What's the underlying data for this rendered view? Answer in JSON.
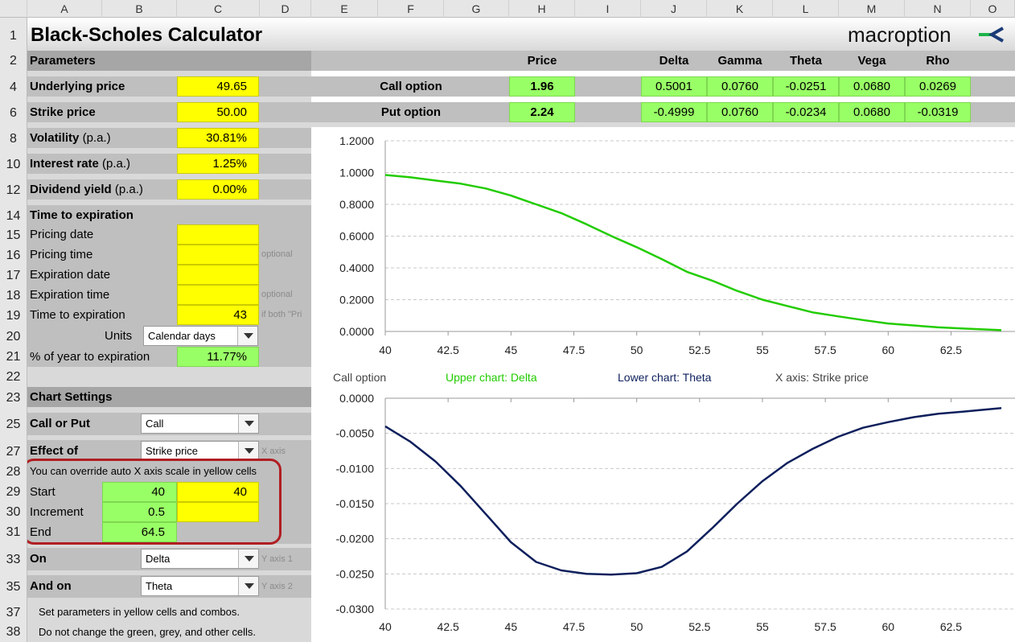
{
  "columns": [
    "A",
    "B",
    "C",
    "D",
    "E",
    "F",
    "G",
    "H",
    "I",
    "J",
    "K",
    "L",
    "M",
    "N",
    "O"
  ],
  "rows": [
    "1",
    "2",
    "4",
    "6",
    "8",
    "10",
    "12",
    "14",
    "15",
    "16",
    "17",
    "18",
    "19",
    "20",
    "21",
    "22",
    "23",
    "25",
    "27",
    "28",
    "29",
    "30",
    "31",
    "33",
    "35",
    "37",
    "38"
  ],
  "title": "Black-Scholes Calculator",
  "logo": {
    "text": "macroption",
    "accent": "#1db34a"
  },
  "params": {
    "header": "Parameters",
    "underlying_label": "Underlying price",
    "underlying_value": "49.65",
    "strike_label": "Strike price",
    "strike_value": "50.00",
    "volatility_label": "Volatility",
    "volatility_suffix": "(p.a.)",
    "volatility_value": "30.81%",
    "interest_label": "Interest rate",
    "interest_suffix": "(p.a.)",
    "interest_value": "1.25%",
    "dividend_label": "Dividend yield",
    "dividend_suffix": "(p.a.)",
    "dividend_value": "0.00%"
  },
  "time": {
    "header": "Time to expiration",
    "pricing_date": "Pricing date",
    "pricing_time": "Pricing time",
    "expiration_date": "Expiration date",
    "expiration_time": "Expiration time",
    "tte_label": "Time to expiration",
    "tte_value": "43",
    "optional1": "optional",
    "optional2": "optional",
    "if_both": "if both \"Pri",
    "units_label": "Units",
    "units_value": "Calendar days",
    "pct_label": "% of year to expiration",
    "pct_value": "11.77%"
  },
  "chart_settings": {
    "header": "Chart Settings",
    "call_put_label": "Call or Put",
    "call_put_value": "Call",
    "effect_label": "Effect of",
    "effect_value": "Strike price",
    "effect_note": "X axis",
    "override_text": "You can override auto X axis scale in yellow cells",
    "start_label": "Start",
    "start_auto": "40",
    "start_override": "40",
    "increment_label": "Increment",
    "increment_auto": "0.5",
    "end_label": "End",
    "end_auto": "64.5",
    "on_label": "On",
    "on_value": "Delta",
    "on_note": "Y axis 1",
    "andon_label": "And on",
    "andon_value": "Theta",
    "andon_note": "Y axis 2",
    "instr1": "Set parameters in yellow cells and combos.",
    "instr2": "Do not change the green, grey, and other cells."
  },
  "greeks": {
    "headers": [
      "Price",
      "Delta",
      "Gamma",
      "Theta",
      "Vega",
      "Rho"
    ],
    "call": {
      "label": "Call option",
      "price": "1.96",
      "delta": "0.5001",
      "gamma": "0.0760",
      "theta": "-0.0251",
      "vega": "0.0680",
      "rho": "0.0269"
    },
    "put": {
      "label": "Put option",
      "price": "2.24",
      "delta": "-0.4999",
      "gamma": "0.0760",
      "theta": "-0.0234",
      "vega": "0.0680",
      "rho": "-0.0319"
    }
  },
  "legend": {
    "option": "Call option",
    "upper": "Upper chart: Delta",
    "lower": "Lower chart: Theta",
    "xaxis": "X axis: Strike price",
    "upper_color": "#22cc00",
    "lower_color": "#0d1f5c"
  },
  "chart_data": [
    {
      "type": "line",
      "series": [
        {
          "name": "Delta",
          "color": "#22cc00"
        }
      ],
      "x": [
        40,
        41,
        42,
        43,
        44,
        45,
        46,
        47,
        48,
        49,
        50,
        51,
        52,
        53,
        54,
        55,
        56,
        57,
        58,
        59,
        60,
        61,
        62,
        63,
        64.5
      ],
      "y": [
        0.985,
        0.97,
        0.95,
        0.93,
        0.9,
        0.855,
        0.8,
        0.745,
        0.675,
        0.6,
        0.53,
        0.455,
        0.375,
        0.32,
        0.255,
        0.2,
        0.16,
        0.12,
        0.095,
        0.072,
        0.05,
        0.038,
        0.026,
        0.018,
        0.008
      ],
      "ylim": [
        0,
        1.2
      ],
      "y_ticks": [
        "1.2000",
        "1.0000",
        "0.8000",
        "0.6000",
        "0.4000",
        "0.2000",
        "0.0000"
      ],
      "x_ticks": [
        "40",
        "42.5",
        "45",
        "47.5",
        "50",
        "52.5",
        "55",
        "57.5",
        "60",
        "62.5"
      ]
    },
    {
      "type": "line",
      "series": [
        {
          "name": "Theta",
          "color": "#0d1f5c"
        }
      ],
      "x": [
        40,
        41,
        42,
        43,
        44,
        45,
        46,
        47,
        48,
        49,
        50,
        51,
        52,
        53,
        54,
        55,
        56,
        57,
        58,
        59,
        60,
        61,
        62,
        63,
        64.5
      ],
      "y": [
        -0.004,
        -0.0062,
        -0.009,
        -0.0125,
        -0.0165,
        -0.0205,
        -0.0233,
        -0.0245,
        -0.025,
        -0.0251,
        -0.0249,
        -0.024,
        -0.0218,
        -0.0185,
        -0.015,
        -0.0118,
        -0.0092,
        -0.0072,
        -0.0055,
        -0.0042,
        -0.0034,
        -0.0027,
        -0.0022,
        -0.0019,
        -0.0014
      ],
      "ylim": [
        -0.03,
        0
      ],
      "y_ticks": [
        "0.0000",
        "-0.0050",
        "-0.0100",
        "-0.0150",
        "-0.0200",
        "-0.0250",
        "-0.0300"
      ],
      "x_ticks": [
        "40",
        "42.5",
        "45",
        "47.5",
        "50",
        "52.5",
        "55",
        "57.5",
        "60",
        "62.5"
      ]
    }
  ]
}
